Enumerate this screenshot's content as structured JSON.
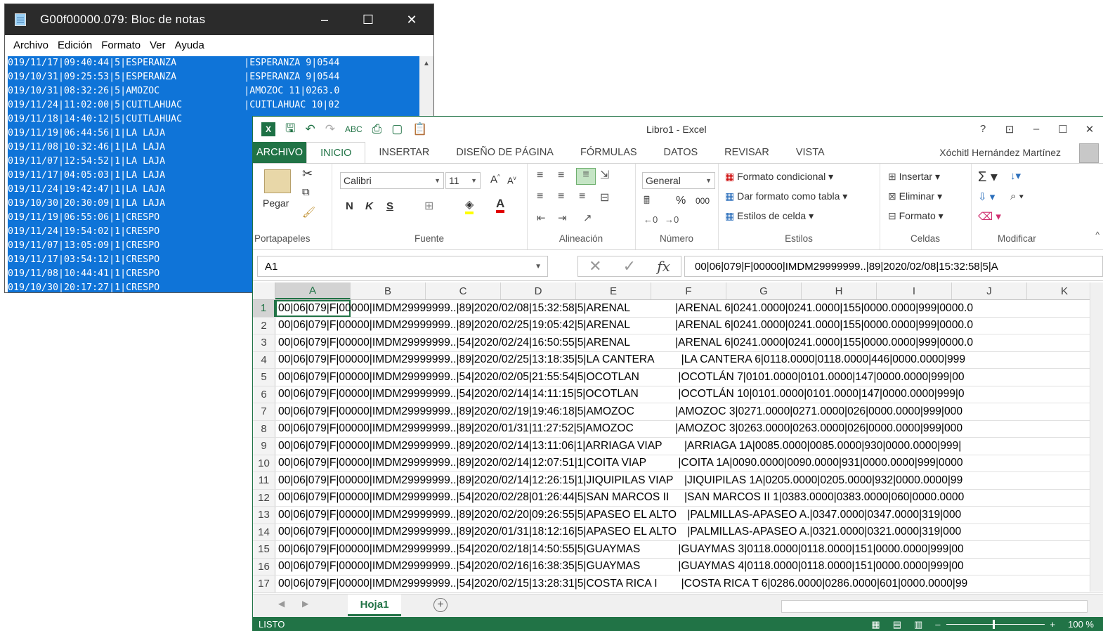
{
  "notepad": {
    "title": "G00f00000.079: Bloc de notas",
    "window_controls": {
      "minimize": "–",
      "maximize": "☐",
      "close": "✕"
    },
    "menu": [
      "Archivo",
      "Edición",
      "Formato",
      "Ver",
      "Ayuda"
    ],
    "lines": [
      "019/11/17|09:40:44|5|ESPERANZA            |ESPERANZA 9|0544",
      "019/10/31|09:25:53|5|ESPERANZA            |ESPERANZA 9|0544",
      "019/10/31|08:32:26|5|AMOZOC               |AMOZOC 11|0263.0",
      "019/11/24|11:02:00|5|CUITLAHUAC           |CUITLAHUAC 10|02",
      "019/11/18|14:40:12|5|CUITLAHUAC",
      "019/11/19|06:44:56|1|LA LAJA",
      "019/11/08|10:32:46|1|LA LAJA",
      "019/11/07|12:54:52|1|LA LAJA",
      "019/11/17|04:05:03|1|LA LAJA",
      "019/11/24|19:42:47|1|LA LAJA",
      "019/10/30|20:30:09|1|LA LAJA",
      "019/11/19|06:55:06|1|CRESPO",
      "019/11/24|19:54:02|1|CRESPO",
      "019/11/07|13:05:09|1|CRESPO",
      "019/11/17|03:54:12|1|CRESPO",
      "019/11/08|10:44:41|1|CRESPO",
      "019/10/30|20:17:27|1|CRESPO"
    ]
  },
  "excel": {
    "title": "Libro1 - Excel",
    "window_controls": {
      "help": "?",
      "ribbon_opts": "⊡",
      "minimize": "–",
      "maximize": "☐",
      "close": "✕"
    },
    "tabs": [
      "ARCHIVO",
      "INICIO",
      "INSERTAR",
      "DISEÑO DE PÁGINA",
      "FÓRMULAS",
      "DATOS",
      "REVISAR",
      "VISTA"
    ],
    "user": "Xóchitl Hernández Martínez",
    "ribbon": {
      "clipboard": {
        "paste": "Pegar",
        "label": "Portapapeles"
      },
      "font": {
        "name": "Calibri",
        "size": "11",
        "bold": "N",
        "italic": "K",
        "underline": "S",
        "label": "Fuente"
      },
      "alignment": {
        "label": "Alineación"
      },
      "number": {
        "format": "General",
        "percent": "%",
        "thousands": "000",
        "label": "Número"
      },
      "styles": {
        "conditional": "Formato condicional",
        "as_table": "Dar formato como tabla",
        "cell_styles": "Estilos de celda",
        "label": "Estilos"
      },
      "cells": {
        "insert": "Insertar",
        "delete": "Eliminar",
        "format": "Formato",
        "label": "Celdas"
      },
      "editing": {
        "label": "Modificar"
      }
    },
    "name_box": "A1",
    "fx": "fx",
    "formula": "00|06|079|F|00000|IMDM29999999..|89|2020/02/08|15:32:58|5|A",
    "columns": [
      "A",
      "B",
      "C",
      "D",
      "E",
      "F",
      "G",
      "H",
      "I",
      "J",
      "K"
    ],
    "rows": [
      {
        "n": "1",
        "a": "00|06|079|F|00000|IMDM29999999..|89|2020/02/08|15:32:58|5|ARENAL",
        "b": "|ARENAL 6|0241.0000|0241.0000|155|0000.0000|999|0000.0"
      },
      {
        "n": "2",
        "a": "00|06|079|F|00000|IMDM29999999..|89|2020/02/25|19:05:42|5|ARENAL",
        "b": "|ARENAL 6|0241.0000|0241.0000|155|0000.0000|999|0000.0"
      },
      {
        "n": "3",
        "a": "00|06|079|F|00000|IMDM29999999..|54|2020/02/24|16:50:55|5|ARENAL",
        "b": "|ARENAL 6|0241.0000|0241.0000|155|0000.0000|999|0000.0"
      },
      {
        "n": "4",
        "a": "00|06|079|F|00000|IMDM29999999..|89|2020/02/25|13:18:35|5|LA CANTERA",
        "b": "  |LA CANTERA 6|0118.0000|0118.0000|446|0000.0000|999"
      },
      {
        "n": "5",
        "a": "00|06|079|F|00000|IMDM29999999..|54|2020/02/05|21:55:54|5|OCOTLAN",
        "b": " |OCOTLÁN 7|0101.0000|0101.0000|147|0000.0000|999|00"
      },
      {
        "n": "6",
        "a": "00|06|079|F|00000|IMDM29999999..|54|2020/02/14|14:11:15|5|OCOTLAN",
        "b": " |OCOTLÁN 10|0101.0000|0101.0000|147|0000.0000|999|0"
      },
      {
        "n": "7",
        "a": "00|06|079|F|00000|IMDM29999999..|89|2020/02/19|19:46:18|5|AMOZOC",
        "b": "|AMOZOC 3|0271.0000|0271.0000|026|0000.0000|999|000"
      },
      {
        "n": "8",
        "a": "00|06|079|F|00000|IMDM29999999..|89|2020/01/31|11:27:52|5|AMOZOC",
        "b": "|AMOZOC 3|0263.0000|0263.0000|026|0000.0000|999|000"
      },
      {
        "n": "9",
        "a": "00|06|079|F|00000|IMDM29999999..|89|2020/02/14|13:11:06|1|ARRIAGA VIAP",
        "b": "   |ARRIAGA 1A|0085.0000|0085.0000|930|0000.0000|999|"
      },
      {
        "n": "10",
        "a": "00|06|079|F|00000|IMDM29999999..|89|2020/02/14|12:07:51|1|COITA VIAP",
        "b": " |COITA 1A|0090.0000|0090.0000|931|0000.0000|999|0000"
      },
      {
        "n": "11",
        "a": "00|06|079|F|00000|IMDM29999999..|89|2020/02/14|12:26:15|1|JIQUIPILAS VIAP",
        "b": "   |JIQUIPILAS 1A|0205.0000|0205.0000|932|0000.0000|99"
      },
      {
        "n": "12",
        "a": "00|06|079|F|00000|IMDM29999999..|54|2020/02/28|01:26:44|5|SAN MARCOS II",
        "b": "   |SAN MARCOS II 1|0383.0000|0383.0000|060|0000.0000"
      },
      {
        "n": "13",
        "a": "00|06|079|F|00000|IMDM29999999..|89|2020/02/20|09:26:55|5|APASEO EL ALTO",
        "b": "    |PALMILLAS-APASEO A.|0347.0000|0347.0000|319|000"
      },
      {
        "n": "14",
        "a": "00|06|079|F|00000|IMDM29999999..|89|2020/01/31|18:12:16|5|APASEO EL ALTO",
        "b": "    |PALMILLAS-APASEO A.|0321.0000|0321.0000|319|000"
      },
      {
        "n": "15",
        "a": "00|06|079|F|00000|IMDM29999999..|54|2020/02/18|14:50:55|5|GUAYMAS",
        "b": " |GUAYMAS 3|0118.0000|0118.0000|151|0000.0000|999|00"
      },
      {
        "n": "16",
        "a": "00|06|079|F|00000|IMDM29999999..|54|2020/02/16|16:38:35|5|GUAYMAS",
        "b": " |GUAYMAS 4|0118.0000|0118.0000|151|0000.0000|999|00"
      },
      {
        "n": "17",
        "a": "00|06|079|F|00000|IMDM29999999..|54|2020/02/15|13:28:31|5|COSTA RICA I",
        "b": "  |COSTA RICA T 6|0286.0000|0286.0000|601|0000.0000|99"
      }
    ],
    "sheet_tab": "Hoja1",
    "add_sheet": "+",
    "status": "LISTO",
    "zoom": "100 %",
    "colors": {
      "accent": "#217346",
      "selection": "#0f74d8"
    }
  }
}
